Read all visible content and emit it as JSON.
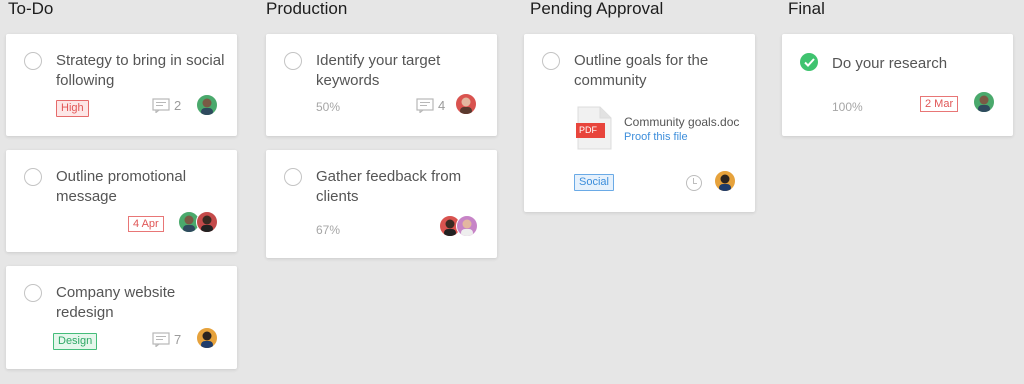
{
  "columns": [
    {
      "title": "To-Do"
    },
    {
      "title": "Production"
    },
    {
      "title": "Pending Approval"
    },
    {
      "title": "Final"
    }
  ],
  "cards": {
    "todo_1": {
      "title": "Strategy to bring in social following",
      "tag": "High",
      "comments": "2"
    },
    "todo_2": {
      "title": "Outline promotional message",
      "date": "4 Apr"
    },
    "todo_3": {
      "title": "Company website redesign",
      "tag": "Design",
      "comments": "7"
    },
    "prod_1": {
      "title": "Identify your target keywords",
      "progress": "50%",
      "comments": "4"
    },
    "prod_2": {
      "title": "Gather feedback from clients",
      "progress": "67%"
    },
    "pend_1": {
      "title": "Outline goals for the community",
      "file": {
        "type_label": "PDF",
        "name": "Community goals.doc",
        "action": "Proof this file"
      },
      "tag": "Social"
    },
    "final_1": {
      "title": "Do your research",
      "progress": "100%",
      "date": "2 Mar"
    }
  },
  "colors": {
    "background": "#e6e6e6",
    "check_done": "#3fc36f",
    "tag_high": "#e25757",
    "tag_design": "#2ea865",
    "tag_social": "#3d8edb"
  },
  "icons": {
    "checkbox": "circle-outline-icon",
    "checkbox_done": "check-circle-icon",
    "comments": "comment-icon",
    "clock": "clock-icon",
    "file": "pdf-file-icon"
  }
}
